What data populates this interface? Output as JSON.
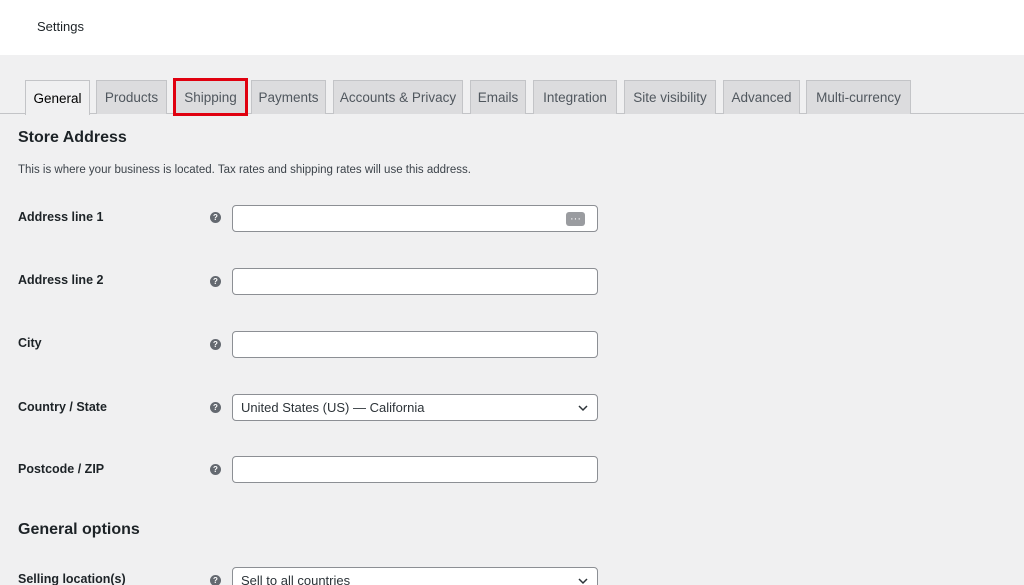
{
  "header": {
    "title": "Settings"
  },
  "tabs": [
    {
      "label": "General"
    },
    {
      "label": "Products"
    },
    {
      "label": "Shipping"
    },
    {
      "label": "Payments"
    },
    {
      "label": "Accounts & Privacy"
    },
    {
      "label": "Emails"
    },
    {
      "label": "Integration"
    },
    {
      "label": "Site visibility"
    },
    {
      "label": "Advanced"
    },
    {
      "label": "Multi-currency"
    }
  ],
  "store_address": {
    "title": "Store Address",
    "description": "This is where your business is located. Tax rates and shipping rates will use this address.",
    "fields": [
      {
        "label": "Address line 1",
        "value": "",
        "icon": "password-manager-icon"
      },
      {
        "label": "Address line 2",
        "value": ""
      },
      {
        "label": "City",
        "value": ""
      },
      {
        "label": "Country / State",
        "value": "United States (US) — California"
      },
      {
        "label": "Postcode / ZIP",
        "value": ""
      }
    ]
  },
  "general_options": {
    "title": "General options",
    "fields": [
      {
        "label": "Selling location(s)",
        "value": "Sell to all countries"
      }
    ]
  },
  "help_glyph": "?",
  "dots_glyph": "···",
  "colors": {
    "highlight": "#e0000f",
    "background": "#f0f0f1",
    "tab_inactive": "#dcdcde"
  }
}
